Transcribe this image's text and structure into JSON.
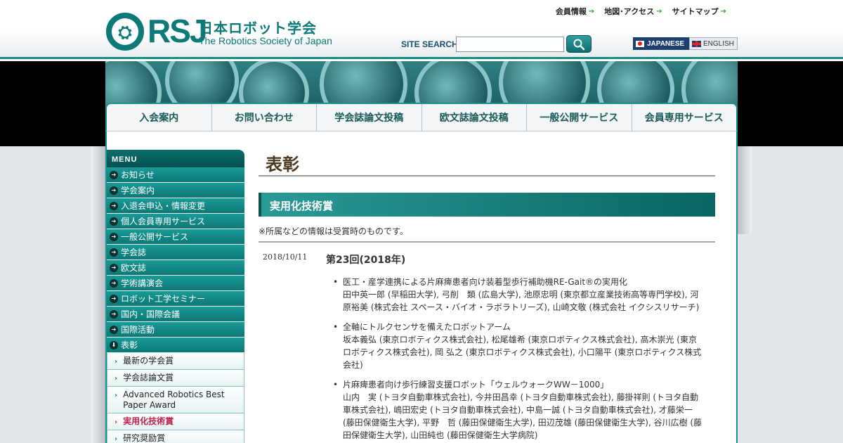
{
  "header": {
    "logo_seal": "The Robotics Society of Japan seal",
    "logo_abbr": "RSJ",
    "logo_ja": "日本ロボット学会",
    "logo_en": "The Robotics Society of Japan",
    "top_links": [
      "会員情報",
      "地図･アクセス",
      "サイトマップ"
    ],
    "search_label": "SITE SEARCH",
    "search_value": "",
    "lang_jp": "JAPANESE",
    "lang_en": "ENGLISH"
  },
  "nav": [
    "入会案内",
    "お問い合わせ",
    "学会誌論文投稿",
    "欧文誌論文投稿",
    "一般公開サービス",
    "会員専用サービス"
  ],
  "sidebar": {
    "header": "MENU",
    "items": [
      "お知らせ",
      "学会案内",
      "入退会申込・情報変更",
      "個人会員専用サービス",
      "一般公開サービス",
      "学会誌",
      "欧文誌",
      "学術講演会",
      "ロボット工学セミナー",
      "国内・国際会議",
      "国際活動",
      "表彰"
    ],
    "sub_items": [
      "最新の学会賞",
      "学会誌論文賞",
      "Advanced Robotics Best Paper Award",
      "実用化技術賞",
      "研究奨励賞"
    ],
    "active_sub": "実用化技術賞"
  },
  "main": {
    "page_title": "表彰",
    "section_title": "実用化技術賞",
    "note": "※所属などの情報は受賞時のものです。",
    "entry": {
      "date": "2018/10/11",
      "title": "第23回(2018年)",
      "awards": [
        {
          "title": "医工・産学連携による片麻痺患者向け装着型歩行補助機RE-Gait®の実用化",
          "authors": "田中英一郎 (早稲田大学), 弓削　類 (広島大学), 池原忠明 (東京都立産業技術高等専門学校), 河原裕美 (株式会社 スペース・バイオ・ラボラトリーズ), 山崎文敬 (株式会社 イクシスリサーチ)"
        },
        {
          "title": "全軸にトルクセンサを備えたロボットアーム",
          "authors": "坂本義弘 (東京ロボティクス株式会社), 松尾雄希 (東京ロボティクス株式会社), 高木崇光 (東京ロボティクス株式会社), 岡 弘之 (東京ロボティクス株式会社), 小口陽平 (東京ロボティクス株式会社)"
        },
        {
          "title": "片麻痺患者向け歩行練習支援ロボット「ウェルウォークWW－1000」",
          "authors": "山内　実 (トヨタ自動車株式会社), 今井田昌幸 (トヨタ自動車株式会社), 藤掛祥則 (トヨタ自動車株式会社), 嶋田宏史 (トヨタ自動車株式会社), 中島一誠 (トヨタ自動車株式会社), 才藤栄一 (藤田保健衛生大学), 平野　哲 (藤田保健衛生大学), 田辺茂雄 (藤田保健衛生大学), 谷川広樹 (藤田保健衛生大学), 山田純也 (藤田保健衛生大学病院)"
        }
      ]
    }
  }
}
